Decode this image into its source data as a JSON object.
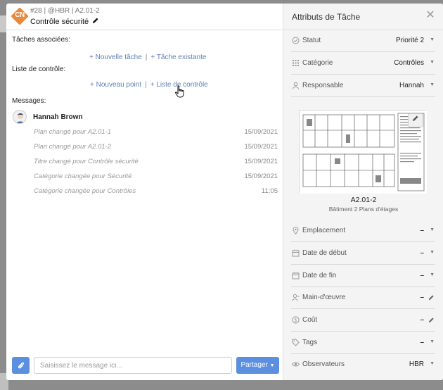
{
  "task": {
    "logo_text": "CN",
    "ident": "#28 | @HBR | A2.01-2",
    "title": "Contrôle sécurité"
  },
  "sections": {
    "associated_tasks": "Tâches associées:",
    "new_task": "+ Nouvelle tâche",
    "existing_task": "+ Tâche existante",
    "checklist": "Liste de contrôle:",
    "new_point": "+ Nouveau point",
    "checklist_link": "+ Liste de contrôle",
    "messages": "Messages:",
    "separator": "|"
  },
  "messages": {
    "user": "Hannah Brown",
    "items": [
      {
        "text": "Plan changé pour A2.01-1",
        "date": "15/09/2021"
      },
      {
        "text": "Plan changé pour A2.01-2",
        "date": "15/09/2021"
      },
      {
        "text": "Titre changé pour Contrôle sécurité",
        "date": "15/09/2021"
      },
      {
        "text": "Catégorie changée pour Sécurité",
        "date": "15/09/2021"
      },
      {
        "text": "Catégorie changée pour Contrôles",
        "date": "11:05"
      }
    ]
  },
  "composer": {
    "placeholder": "Saisissez le message ici...",
    "value": "",
    "share_label": "Partager"
  },
  "panel": {
    "title": "Attributs de Tâche",
    "attributes_top": [
      {
        "label": "Statut",
        "value": "Priorité 2",
        "icon": "check-circle-icon"
      },
      {
        "label": "Catégorie",
        "value": "Contrôles",
        "icon": "grid-icon"
      },
      {
        "label": "Responsable",
        "value": "Hannah",
        "icon": "user-icon"
      }
    ],
    "plan": {
      "name": "A2.01-2",
      "subtitle": "Bâtiment 2 Plans d'étages"
    },
    "attributes_bottom": [
      {
        "label": "Emplacement",
        "value": "–",
        "icon": "location-pin-icon"
      },
      {
        "label": "Date de début",
        "value": "–",
        "icon": "calendar-icon"
      },
      {
        "label": "Date de fin",
        "value": "–",
        "icon": "calendar-icon"
      },
      {
        "label": "Main-d'œuvre",
        "value": "–",
        "icon": "user-outline-icon"
      },
      {
        "label": "Coût",
        "value": "–",
        "icon": "dollar-icon"
      },
      {
        "label": "Tags",
        "value": "–",
        "icon": "tag-icon"
      },
      {
        "label": "Observateurs",
        "value": "HBR",
        "icon": "eye-icon"
      }
    ]
  },
  "colors": {
    "accent": "#5b8fe0",
    "logo": "#e98a3c",
    "link": "#5e7fb5"
  }
}
